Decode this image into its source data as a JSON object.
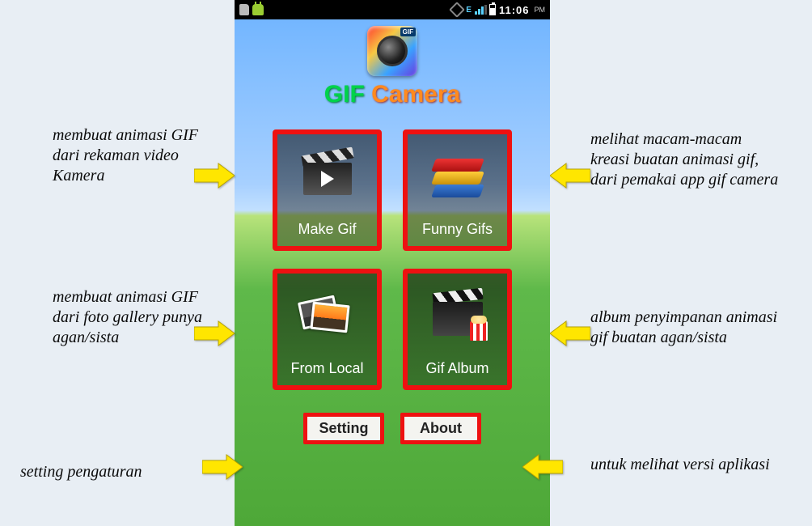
{
  "statusbar": {
    "time": "11:06",
    "ampm": "PM"
  },
  "app": {
    "badge": "GIF",
    "title_gif": "GIF",
    "title_camera": " Camera"
  },
  "tiles": {
    "make_gif": "Make Gif",
    "funny_gifs": "Funny Gifs",
    "from_local": "From Local",
    "gif_album": "Gif Album"
  },
  "buttons": {
    "setting": "Setting",
    "about": "About"
  },
  "annotations": {
    "make_gif": "membuat animasi GIF dari rekaman video Kamera",
    "funny_gifs": "melihat macam-macam kreasi buatan animasi gif, dari pemakai app gif camera",
    "from_local": "membuat animasi GIF dari foto gallery punya agan/sista",
    "gif_album": "album penyimpanan animasi gif buatan agan/sista",
    "setting": "setting pengaturan",
    "about": "untuk melihat versi aplikasi"
  }
}
